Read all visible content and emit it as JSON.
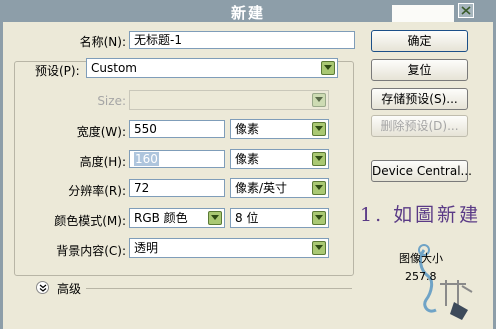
{
  "window": {
    "title": "新建"
  },
  "form": {
    "name_label": "名称(N):",
    "name_value": "无标题-1",
    "preset_label": "预设(P):",
    "preset_value": "Custom",
    "size_label": "Size:",
    "size_value": "",
    "width_label": "宽度(W):",
    "width_value": "550",
    "width_unit": "像素",
    "height_label": "高度(H):",
    "height_value": "160",
    "height_unit": "像素",
    "resolution_label": "分辨率(R):",
    "resolution_value": "72",
    "resolution_unit": "像素/英寸",
    "color_mode_label": "颜色模式(M):",
    "color_mode_value": "RGB 颜色",
    "bit_depth_value": "8 位",
    "background_label": "背景内容(C):",
    "background_value": "透明",
    "advanced_label": "高级"
  },
  "buttons": {
    "ok": "确定",
    "reset": "复位",
    "save_preset": "存储预设(S)...",
    "delete_preset": "删除预设(D)...",
    "device_central": "Device Central..."
  },
  "info": {
    "caption": "1. 如圖新建",
    "image_size_label": "图像大小",
    "image_size_value": "257.8"
  },
  "colors": {
    "titlebar": "#8d9ea9",
    "dialog_bg": "#ece9d8",
    "caption": "#5a3a86",
    "dropdown_arrow": "#a9c873"
  }
}
